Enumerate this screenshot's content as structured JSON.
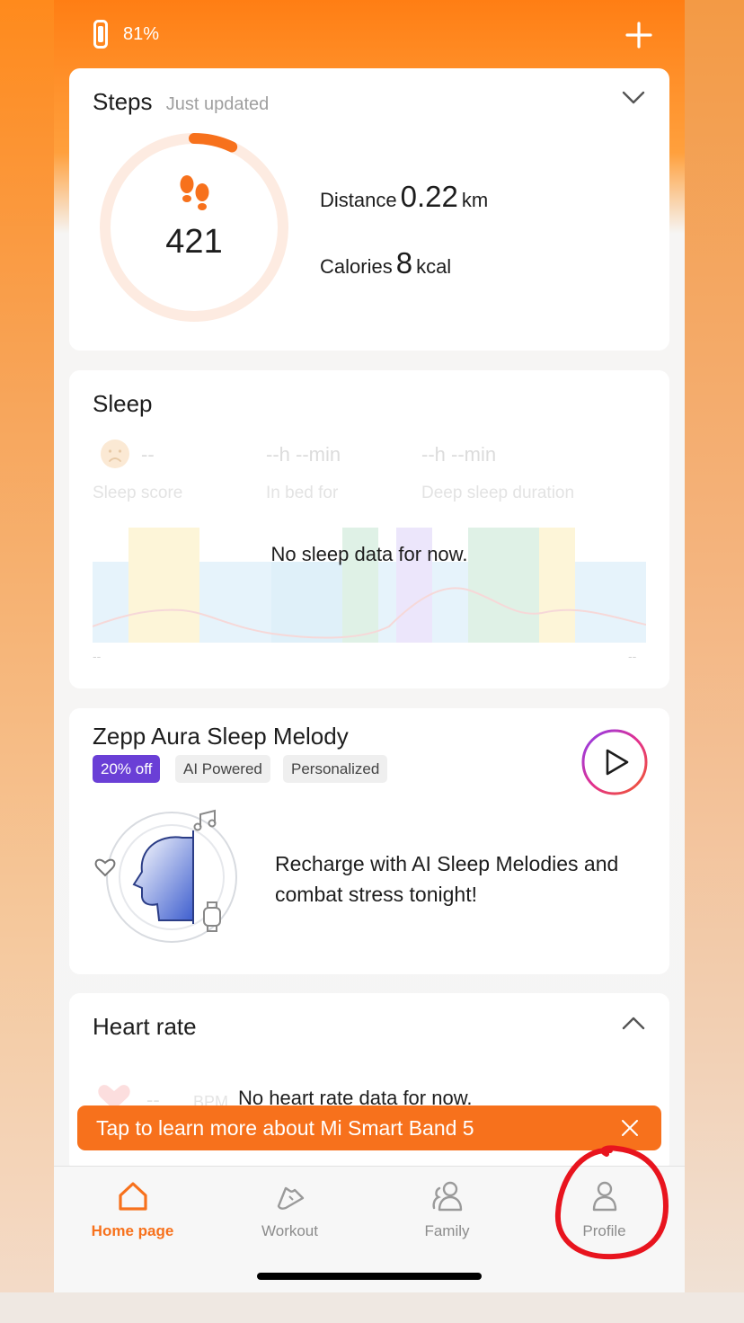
{
  "status": {
    "battery": "81%"
  },
  "steps": {
    "title": "Steps",
    "updated": "Just updated",
    "count": "421",
    "progress_fraction": 0.07,
    "distance_label": "Distance",
    "distance_value": "0.22",
    "distance_unit": "km",
    "calories_label": "Calories",
    "calories_value": "8",
    "calories_unit": "kcal"
  },
  "sleep": {
    "title": "Sleep",
    "score_value": "--",
    "score_label": "Sleep score",
    "in_bed_value": "--h --min",
    "in_bed_label": "In bed for",
    "deep_value": "--h --min",
    "deep_label": "Deep sleep duration",
    "no_data": "No sleep data for now.",
    "axis_start": "--",
    "axis_end": "--"
  },
  "melody": {
    "title": "Zepp Aura Sleep Melody",
    "tags": [
      "20% off",
      "AI Powered",
      "Personalized"
    ],
    "description": "Recharge with AI Sleep Melodies and combat stress tonight!"
  },
  "heart_rate": {
    "title": "Heart rate",
    "value": "--",
    "unit": "BPM",
    "no_data": "No heart rate data for now."
  },
  "banner": {
    "text": "Tap to learn more about Mi Smart Band 5"
  },
  "nav": {
    "items": [
      {
        "label": "Home page",
        "icon": "home-icon",
        "active": true
      },
      {
        "label": "Workout",
        "icon": "shoe-icon",
        "active": false
      },
      {
        "label": "Family",
        "icon": "family-icon",
        "active": false
      },
      {
        "label": "Profile",
        "icon": "profile-icon",
        "active": false
      }
    ]
  },
  "colors": {
    "accent": "#f7711c",
    "discount_tag": "#6a3fd6",
    "annotation": "#e8141e"
  }
}
